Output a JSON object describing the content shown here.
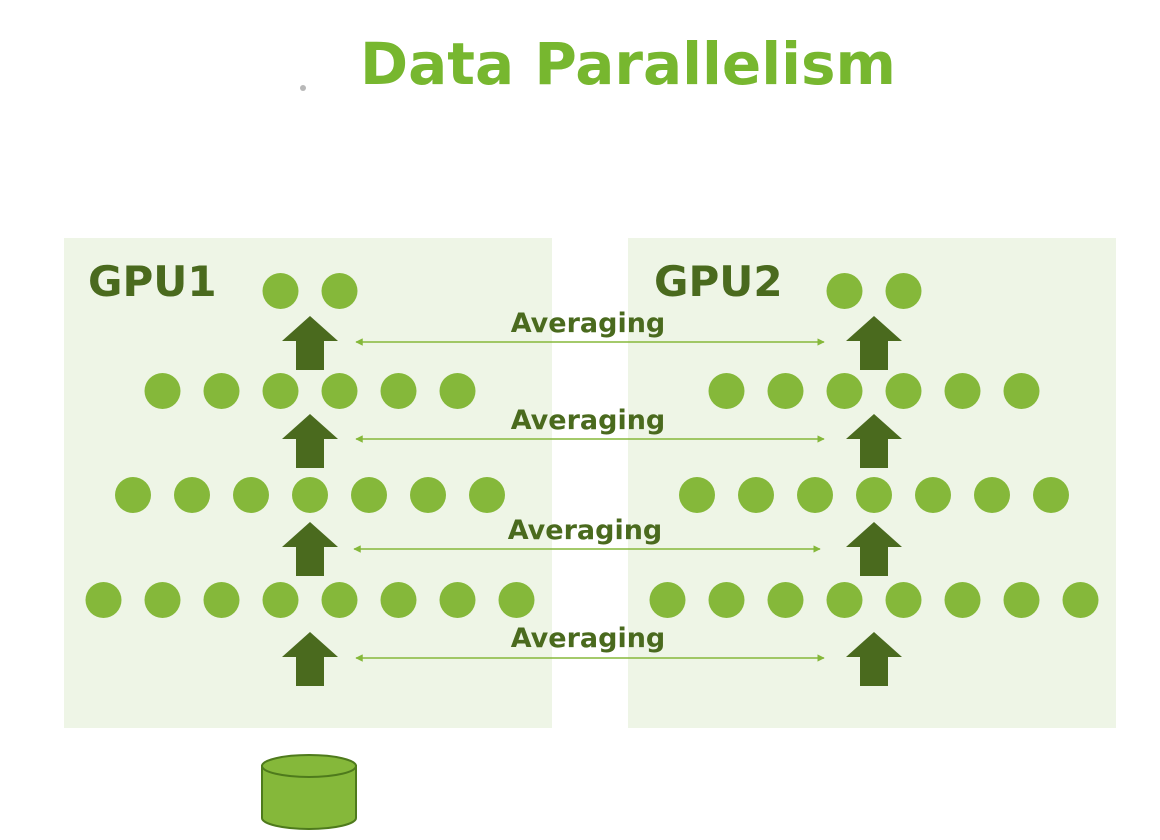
{
  "title": "Data Parallelism",
  "gpus": [
    {
      "label": "GPU1",
      "layer_neuron_counts": [
        2,
        6,
        7,
        8
      ]
    },
    {
      "label": "GPU2",
      "layer_neuron_counts": [
        2,
        6,
        7,
        8
      ]
    }
  ],
  "averaging_labels": [
    "Averaging",
    "Averaging",
    "Averaging",
    "Averaging"
  ],
  "colors": {
    "title": "#77b72f",
    "gpu_background": "#eef5e6",
    "gpu_label": "#4a6a1e",
    "neuron": "#85b83a",
    "arrow": "#4a6a1e",
    "averaging_text": "#4a6a1e",
    "averaging_line": "#85b83a",
    "database": "#85b83a",
    "database_border": "#4e7a1c"
  },
  "icons": {
    "data_source": "database-icon",
    "flow": "arrow-up-icon",
    "bullet": "bullet-dot-icon"
  }
}
